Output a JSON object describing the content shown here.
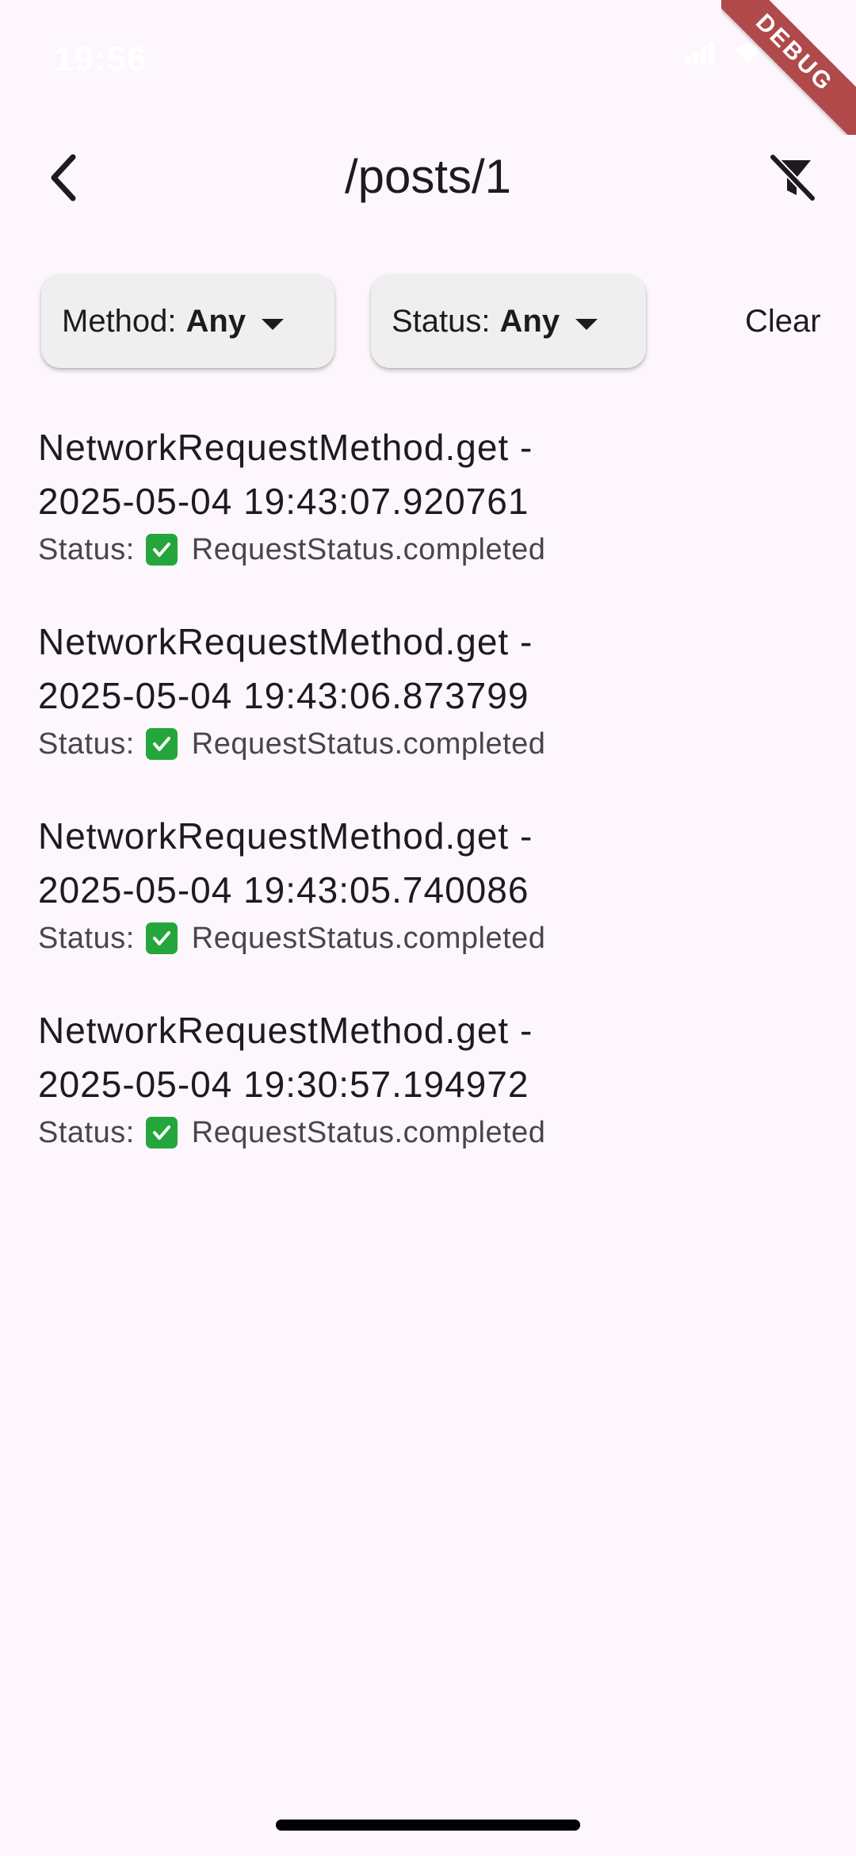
{
  "status_bar": {
    "time": "19:56",
    "icons": [
      "signal-icon",
      "wifi-icon",
      "battery-icon"
    ]
  },
  "debug_banner": "DEBUG",
  "app_bar": {
    "title": "/posts/1",
    "back_icon": "back-chevron-icon",
    "action_icon": "filter-off-icon"
  },
  "filters": {
    "method": {
      "label": "Method:",
      "value": "Any"
    },
    "status": {
      "label": "Status:",
      "value": "Any"
    },
    "clear_label": "Clear"
  },
  "requests": [
    {
      "title_line1": "NetworkRequestMethod.get -",
      "title_line2": "2025-05-04 19:43:07.920761",
      "status_label": "Status:",
      "status_value": "RequestStatus.completed"
    },
    {
      "title_line1": "NetworkRequestMethod.get -",
      "title_line2": "2025-05-04 19:43:06.873799",
      "status_label": "Status:",
      "status_value": "RequestStatus.completed"
    },
    {
      "title_line1": "NetworkRequestMethod.get -",
      "title_line2": "2025-05-04 19:43:05.740086",
      "status_label": "Status:",
      "status_value": "RequestStatus.completed"
    },
    {
      "title_line1": "NetworkRequestMethod.get -",
      "title_line2": "2025-05-04 19:30:57.194972",
      "status_label": "Status:",
      "status_value": "RequestStatus.completed"
    }
  ],
  "colors": {
    "background": "#fdf7fd",
    "chip_background": "#efefef",
    "check_green": "#24a63c",
    "debug_ribbon": "#b0494a"
  }
}
